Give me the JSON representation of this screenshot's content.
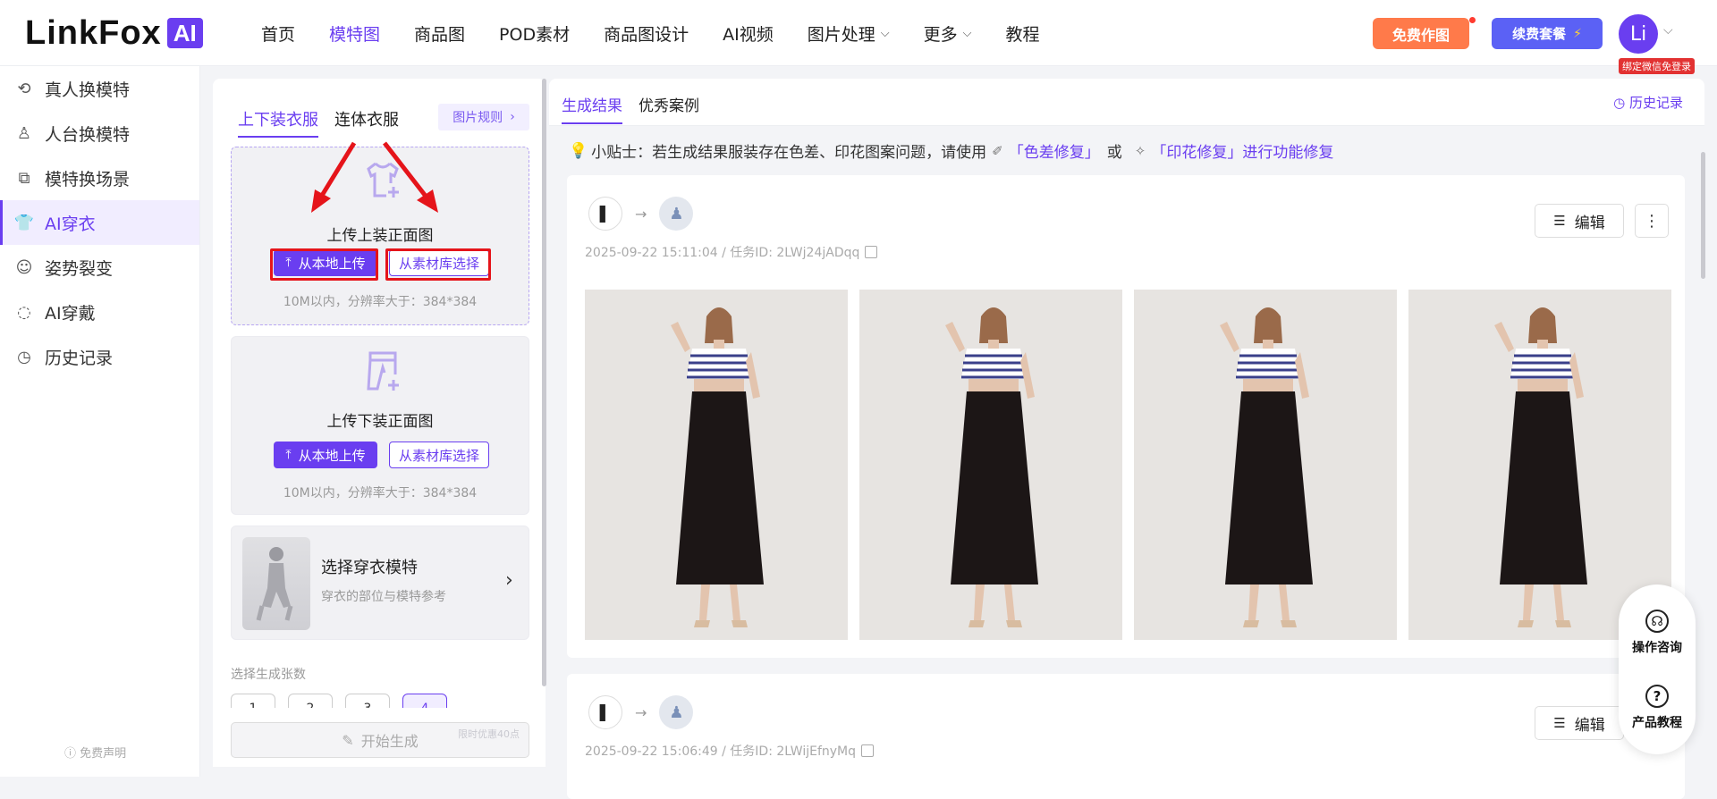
{
  "brand": {
    "logo_text": "LinkFox",
    "logo_badge": "AI"
  },
  "nav": {
    "items": [
      {
        "label": "首页",
        "active": false,
        "dropdown": false
      },
      {
        "label": "模特图",
        "active": true,
        "dropdown": false
      },
      {
        "label": "商品图",
        "active": false,
        "dropdown": false
      },
      {
        "label": "POD素材",
        "active": false,
        "dropdown": false
      },
      {
        "label": "商品图设计",
        "active": false,
        "dropdown": false
      },
      {
        "label": "AI视频",
        "active": false,
        "dropdown": false
      },
      {
        "label": "图片处理",
        "active": false,
        "dropdown": true
      },
      {
        "label": "更多",
        "active": false,
        "dropdown": true
      },
      {
        "label": "教程",
        "active": false,
        "dropdown": false
      }
    ],
    "free_button": "免费作图",
    "renew_button": "续费套餐",
    "avatar_text": "Li",
    "wechat_badge": "绑定微信免登录"
  },
  "sidebar": {
    "items": [
      {
        "label": "真人换模特",
        "icon": "person-swap-icon",
        "active": false
      },
      {
        "label": "人台换模特",
        "icon": "mannequin-icon",
        "active": false
      },
      {
        "label": "模特换场景",
        "icon": "scene-swap-icon",
        "active": false
      },
      {
        "label": "AI穿衣",
        "icon": "shirt-icon",
        "active": true
      },
      {
        "label": "姿势裂变",
        "icon": "pose-icon",
        "active": false
      },
      {
        "label": "AI穿戴",
        "icon": "accessory-icon",
        "active": false
      },
      {
        "label": "历史记录",
        "icon": "history-icon",
        "active": false
      }
    ],
    "disclaimer": "免费声明"
  },
  "left_panel": {
    "tabs": [
      {
        "label": "上下装衣服",
        "active": true
      },
      {
        "label": "连体衣服",
        "active": false
      }
    ],
    "rule_button": "图片规则",
    "top_upload": {
      "title": "上传上装正面图",
      "local_button": "从本地上传",
      "library_button": "从素材库选择",
      "note": "10M以内，分辨率大于：384*384"
    },
    "bottom_upload": {
      "title": "上传下装正面图",
      "local_button": "从本地上传",
      "library_button": "从素材库选择",
      "note": "10M以内，分辨率大于：384*384"
    },
    "model_select": {
      "title": "选择穿衣模特",
      "subtitle": "穿衣的部位与模特参考"
    },
    "count_label": "选择生成张数",
    "count_options": [
      "1",
      "2",
      "3",
      "4"
    ],
    "count_selected": "4",
    "generate_button": "开始生成",
    "generate_promo": "限时优惠40点"
  },
  "results": {
    "tabs": [
      {
        "label": "生成结果",
        "active": true
      },
      {
        "label": "优秀案例",
        "active": false
      }
    ],
    "history_link": "历史记录",
    "tip": {
      "prefix": "小贴士：若生成结果服装存在色差、印花图案问题，请使用",
      "link1": "「色差修复」",
      "middle": "或",
      "link2": "「印花修复」进行功能修复"
    },
    "tasks": [
      {
        "meta": "2025-09-22 15:11:04 / 任务ID: 2LWj24jADqq",
        "edit_button": "编辑",
        "image_count": 4
      },
      {
        "meta": "2025-09-22 15:06:49 / 任务ID: 2LWijEfnyMq",
        "edit_button": "编辑",
        "image_count": 0
      }
    ]
  },
  "float_bar": {
    "consult": "操作咨询",
    "tutorial": "产品教程"
  },
  "colors": {
    "accent": "#6a3ef0",
    "free_btn": "#ff7a4a",
    "renew_btn": "#5b61f5",
    "highlight": "#e5141a"
  }
}
